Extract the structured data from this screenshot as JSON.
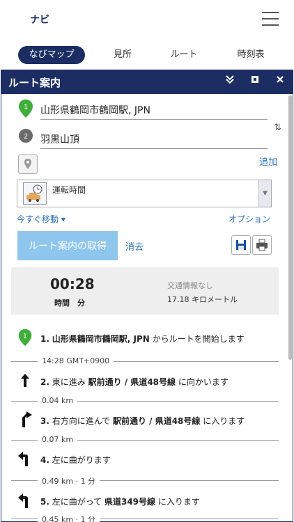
{
  "app": {
    "title": "ナビ"
  },
  "tabs": [
    {
      "label": "なびマップ"
    },
    {
      "label": "見所"
    },
    {
      "label": "ルート"
    },
    {
      "label": "時刻表"
    }
  ],
  "panel": {
    "title": "ルート案内"
  },
  "waypoints": [
    {
      "number": "1",
      "value": "山形県鶴岡市鶴岡駅, JPN",
      "color": "#3fae3a"
    },
    {
      "number": "2",
      "value": "羽黒山頂",
      "color": "#6b6b6b"
    }
  ],
  "add_label": "追加",
  "swap_symbol": "⇅",
  "travel_mode": {
    "label": "運転時間"
  },
  "depart_label": "今すぐ移動 ▾",
  "options_label": "オプション",
  "get_route_label": "ルート案内の取得",
  "clear_label": "消去",
  "summary": {
    "time": "00:28",
    "time_unit": "時間　分",
    "traffic": "交通情報なし",
    "distance": "17.18 キロメートル"
  },
  "steps": [
    {
      "num": "1.",
      "pre": "",
      "bold": "山形県鶴岡市鶴岡駅, JPN",
      "post": " からルートを開始します"
    },
    {
      "num": "2.",
      "pre": "東に進み ",
      "bold": "駅前通り / 県道48号線",
      "post": " に向かいます"
    },
    {
      "num": "3.",
      "pre": "右方向に進んで ",
      "bold": "駅前通り / 県道48号線",
      "post": " に入ります"
    },
    {
      "num": "4.",
      "pre": "左に曲がります",
      "bold": "",
      "post": ""
    },
    {
      "num": "5.",
      "pre": "左に曲がって ",
      "bold": "県道349号線",
      "post": " に入ります"
    }
  ],
  "separators": [
    "14:28 GMT+0900",
    "0.04 km",
    "0.07 km",
    "0.49 km · 1 分",
    "0.45 km · 1 分"
  ],
  "colors": {
    "brand": "#1b2d63",
    "link": "#2a6fb8",
    "button": "#8ec6ee"
  }
}
